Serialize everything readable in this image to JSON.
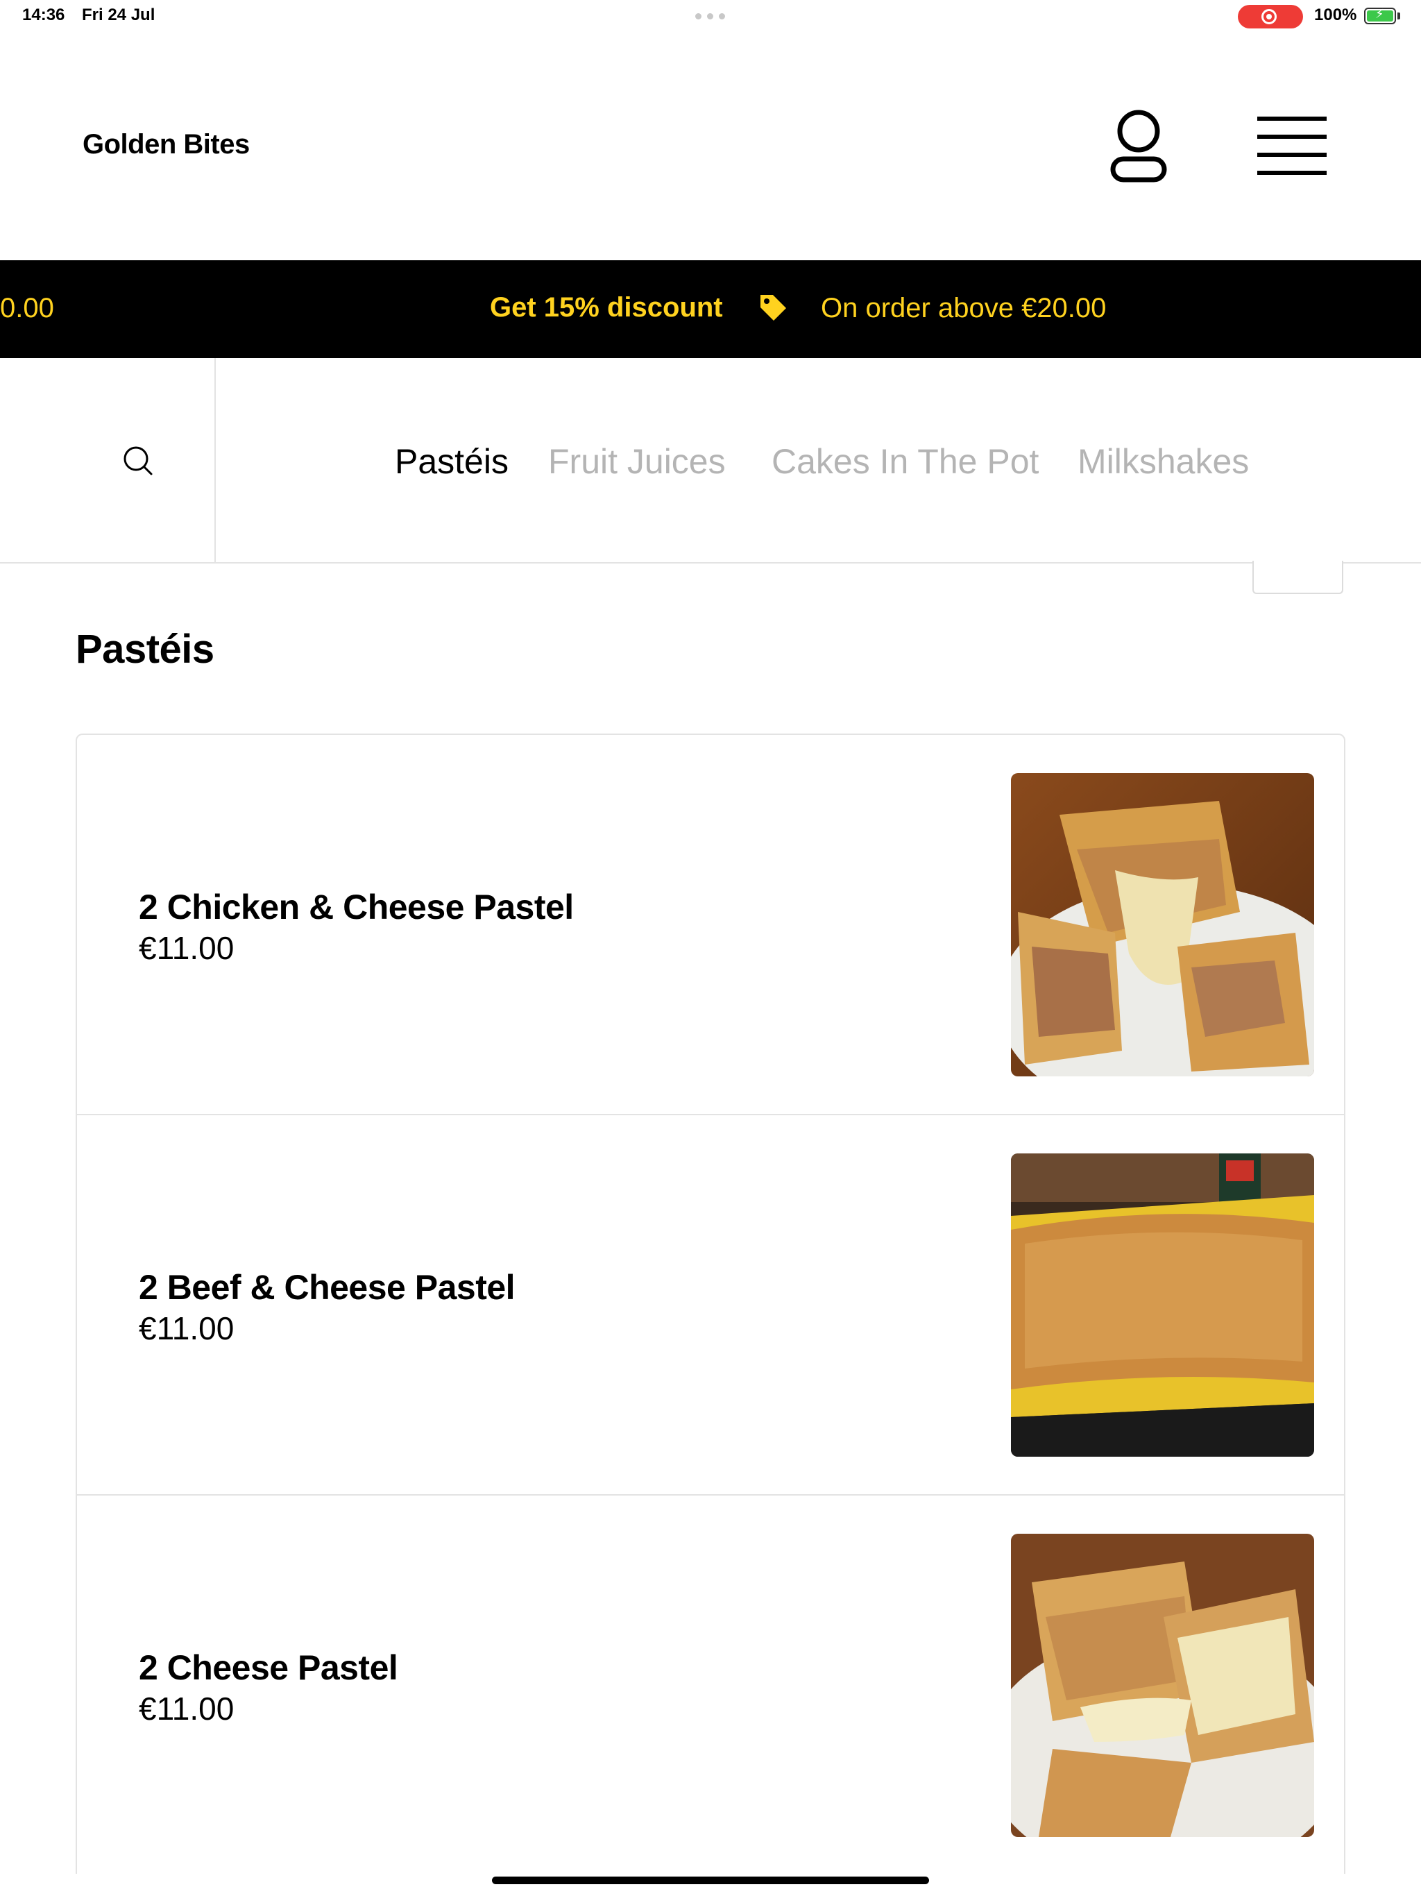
{
  "status_bar": {
    "time": "14:36",
    "date": "Fri 24 Jul",
    "battery": "100%",
    "icons": [
      "screen-recording-icon",
      "battery-charging-icon"
    ]
  },
  "header": {
    "brand": "Golden Bites",
    "icons": [
      "user-icon",
      "hamburger-menu-icon"
    ]
  },
  "promo": {
    "scroll_fragment": "0.00",
    "main": "Get 15% discount",
    "sub": "On order above €20.00",
    "icon": "price-tag-icon",
    "text_color": "#ffd21f",
    "background": "#000000"
  },
  "categories": {
    "search_icon": "search-icon",
    "tabs": [
      {
        "label": "Pastéis",
        "active": true
      },
      {
        "label": "Fruit Juices",
        "active": false
      },
      {
        "label": "Cakes In The Pot",
        "active": false
      },
      {
        "label": "Milkshakes",
        "active": false
      }
    ]
  },
  "section": {
    "title": "Pastéis",
    "products": [
      {
        "name": "2 Chicken & Cheese Pastel",
        "price": "€11.00"
      },
      {
        "name": "2 Beef & Cheese Pastel",
        "price": "€11.00"
      },
      {
        "name": "2 Cheese Pastel",
        "price": "€11.00"
      }
    ]
  }
}
